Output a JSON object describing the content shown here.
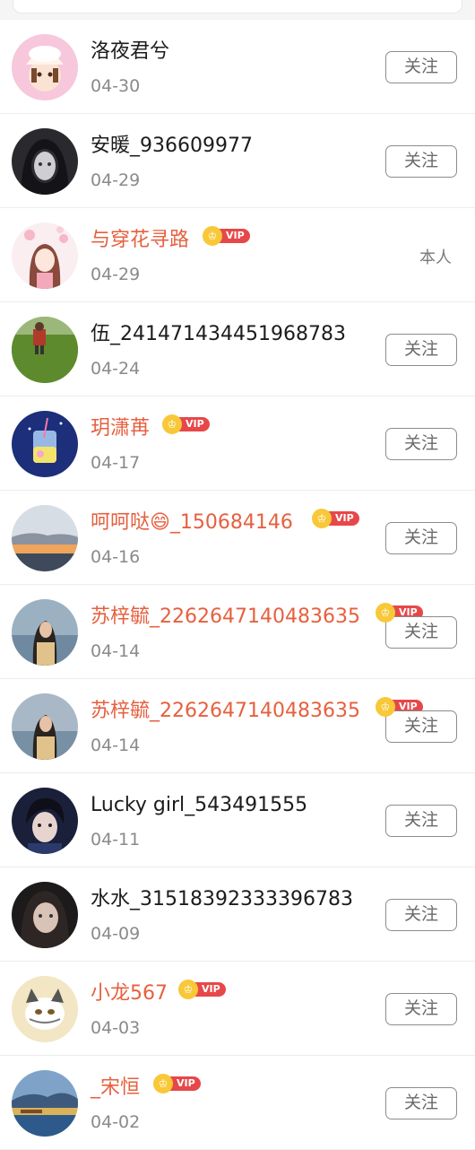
{
  "colors": {
    "vip_name": "#e6603f",
    "vip_badge": "#e6484a",
    "crown": "#f8c838"
  },
  "badge": {
    "text": "VIP",
    "icon": "crown-icon"
  },
  "rows": [
    {
      "name": "洛夜君兮",
      "date": "04-30",
      "vip": false,
      "action": "关注"
    },
    {
      "name": "安暖_936609977",
      "date": "04-29",
      "vip": false,
      "action": "关注"
    },
    {
      "name": "与穿花寻路",
      "date": "04-29",
      "vip": true,
      "action": "本人"
    },
    {
      "name": "伍_241471434451968783",
      "date": "04-24",
      "vip": false,
      "action": "关注"
    },
    {
      "name": "玥潇苒",
      "date": "04-17",
      "vip": true,
      "action": "关注"
    },
    {
      "name": "呵呵哒😄_150684146",
      "date": "04-16",
      "vip": true,
      "action": "关注"
    },
    {
      "name": "苏梓毓_2262647140483635",
      "date": "04-14",
      "vip": true,
      "action": "关注"
    },
    {
      "name": "苏梓毓_2262647140483635",
      "date": "04-14",
      "vip": true,
      "action": "关注"
    },
    {
      "name": "Lucky girl_543491555",
      "date": "04-11",
      "vip": false,
      "action": "关注"
    },
    {
      "name": "水水_31518392333396783",
      "date": "04-09",
      "vip": false,
      "action": "关注"
    },
    {
      "name": "小龙567",
      "date": "04-03",
      "vip": true,
      "action": "关注"
    },
    {
      "name": "_宋恒",
      "date": "04-02",
      "vip": true,
      "action": "关注"
    }
  ]
}
